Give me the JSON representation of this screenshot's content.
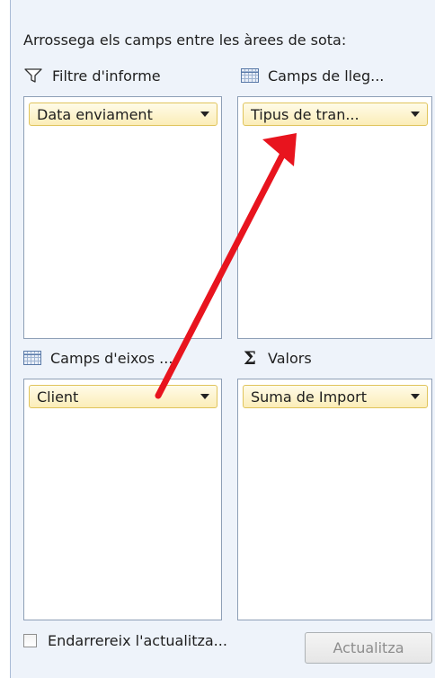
{
  "instruction": "Arrossega els camps entre les àrees de sota:",
  "areas": {
    "report_filter": {
      "header": "Filtre d'informe",
      "icon": "filter-icon",
      "field": "Data enviament"
    },
    "column_labels": {
      "header": "Camps de lleg...",
      "icon": "grid-icon",
      "field": "Tipus de tran..."
    },
    "row_labels": {
      "header": "Camps d'eixos ...",
      "icon": "grid-icon",
      "field": "Client"
    },
    "values": {
      "header": "Valors",
      "icon": "sigma-icon",
      "field": "Suma de Import"
    }
  },
  "defer_update": {
    "label": "Endarrereix l'actualitza...",
    "checked": false
  },
  "update_button": "Actualitza",
  "colors": {
    "pane_background": "#eef3fa",
    "field_pill": "#fbedb8",
    "annotation_arrow": "#e8141e"
  }
}
